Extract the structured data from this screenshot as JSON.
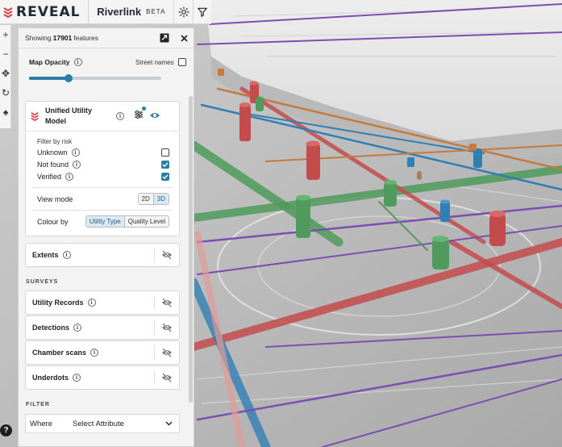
{
  "app": {
    "brand": "REVEAL",
    "project": "Riverlink",
    "badge": "BETA"
  },
  "toolbar": {
    "settings_icon": "gear-icon",
    "filter_icon": "funnel-icon"
  },
  "tools": [
    "+",
    "−",
    "✥",
    "↻",
    "♠"
  ],
  "panel": {
    "showing_prefix": "Showing",
    "showing_count": "17901",
    "showing_suffix": "features",
    "map_opacity_label": "Map Opacity",
    "map_opacity_value": 0.3,
    "street_names_label": "Street names",
    "street_names_checked": false,
    "layer": {
      "title": "Unified Utility Model",
      "filter_by_risk_label": "Filter by risk",
      "risk_options": [
        {
          "label": "Unknown",
          "checked": false
        },
        {
          "label": "Not found",
          "checked": true
        },
        {
          "label": "Verified",
          "checked": true
        }
      ],
      "view_mode_label": "View mode",
      "view_modes": [
        "2D",
        "3D"
      ],
      "view_mode_active": "3D",
      "colour_by_label": "Colour by",
      "colour_by_options": [
        "Utility Type",
        "Quality Level"
      ],
      "colour_by_active": "Utility Type"
    },
    "extents_label": "Extents",
    "surveys_title": "SURVEYS",
    "surveys": [
      "Utility Records",
      "Detections",
      "Chamber scans",
      "Underdots"
    ],
    "filter_title": "FILTER",
    "where_label": "Where",
    "attribute_select": "Select Attribute"
  },
  "help_label": "?",
  "colors": {
    "accent": "#2a7fa3",
    "brand_red": "#d6404a"
  }
}
